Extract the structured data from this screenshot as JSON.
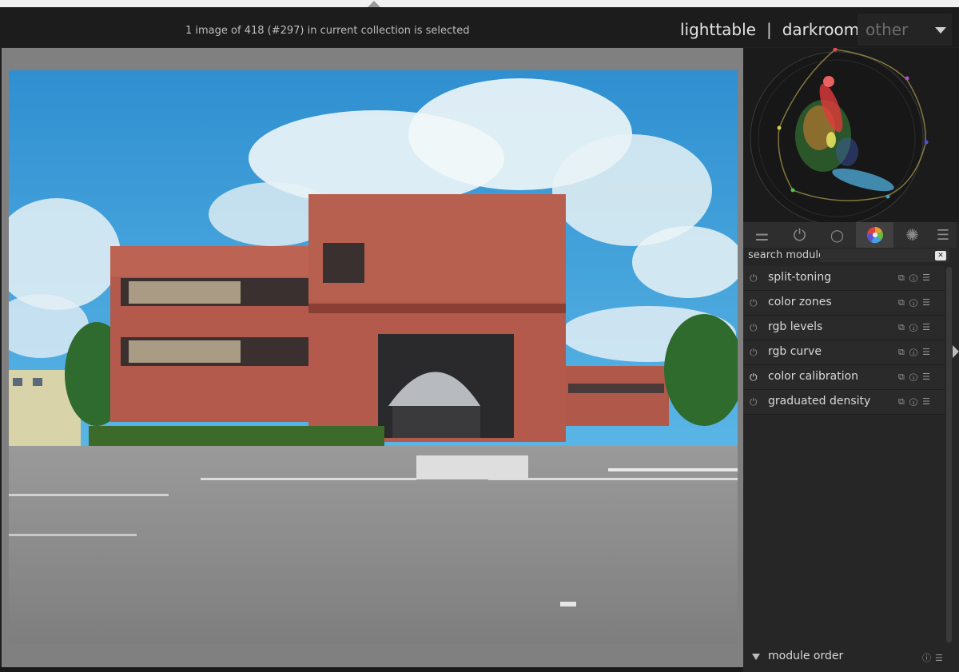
{
  "header": {
    "status_text": "1 image of 418 (#297) in current collection is selected",
    "views": {
      "lighttable": "lighttable",
      "separator": "|",
      "darkroom": "darkroom",
      "other": "other"
    }
  },
  "tabs": [
    {
      "icon": "sliders-icon",
      "glyph": "⚌"
    },
    {
      "icon": "power-icon",
      "glyph": "⏻"
    },
    {
      "icon": "circle-icon",
      "glyph": "○"
    },
    {
      "icon": "color-wheel-icon",
      "glyph": "",
      "active": true
    },
    {
      "icon": "aperture-icon",
      "glyph": "✺"
    }
  ],
  "tab_menu_glyph": "☰",
  "search": {
    "label": "search module",
    "value": "",
    "clear_glyph": "✕"
  },
  "modules": [
    {
      "name": "split-toning"
    },
    {
      "name": "color zones"
    },
    {
      "name": "rgb levels"
    },
    {
      "name": "rgb curve"
    },
    {
      "name": "color calibration",
      "enabled": true
    },
    {
      "name": "graduated density"
    }
  ],
  "module_glyphs": {
    "power": "⏻",
    "icons": "⧉ⓘ☰"
  },
  "module_order": {
    "label": "module order",
    "icons": "ⓘ☰"
  },
  "colors": {
    "sky": "#3a9ed8",
    "brick": "#b35a4c",
    "road": "#8e8e8e",
    "panel": "#262626"
  }
}
